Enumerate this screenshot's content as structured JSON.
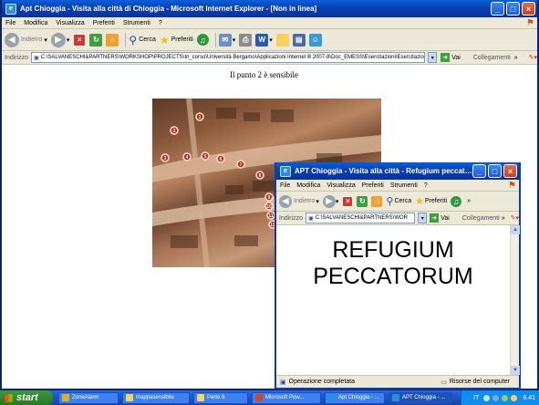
{
  "main_window": {
    "title": "Apt Chioggia - Visita alla città di Chioggia - Microsoft Internet Explorer - [Non in linea]",
    "menu": [
      "File",
      "Modifica",
      "Visualizza",
      "Preferiti",
      "Strumenti",
      "?"
    ],
    "toolbar": {
      "back_label": "Indietro",
      "search_label": "Cerca",
      "favorites_label": "Preferiti"
    },
    "address_label": "Indirizzo",
    "address_value": "C:\\SALVANESCHI&PARTNERS\\WORKSHOP\\PROJECTS\\In_corso\\Università Bergamo\\Applicazioni Internet B 2007-8\\Doc_EMESS\\Esercitazioni\\Esercitazio",
    "go_label": "Vai",
    "links_label": "Collegamenti",
    "heading": "Il punto 2 è sensibile",
    "map_numbers": [
      "1",
      "2",
      "3",
      "4",
      "5",
      "6",
      "7",
      "8",
      "9",
      "10",
      "11",
      "12"
    ]
  },
  "popup_window": {
    "title": "APT Chioggia - Visita alla città - Refugium peccatorum - ...",
    "menu": [
      "File",
      "Modifica",
      "Visualizza",
      "Preferiti",
      "Strumenti",
      "?"
    ],
    "toolbar": {
      "back_label": "Indietro",
      "search_label": "Cerca",
      "favorites_label": "Preferiti"
    },
    "address_label": "Indirizzo",
    "address_value": "C:\\SALVANESCHI&PARTNERS\\WOR",
    "go_label": "Vai",
    "links_label": "Collegamenti",
    "heading_line1": "REFUGIUM",
    "heading_line2": "PECCATORUM",
    "status_left": "Operazione completata",
    "status_right": "Risorse del computer"
  },
  "taskbar": {
    "start_label": "start",
    "tasks": [
      "ZoneAlarm",
      "mappasensibile",
      "Parte 8",
      "Microsoft Pow...",
      "Apt Chioggia - ...",
      "APT Chioggia - ..."
    ],
    "lang": "IT",
    "clock": "9.41"
  }
}
